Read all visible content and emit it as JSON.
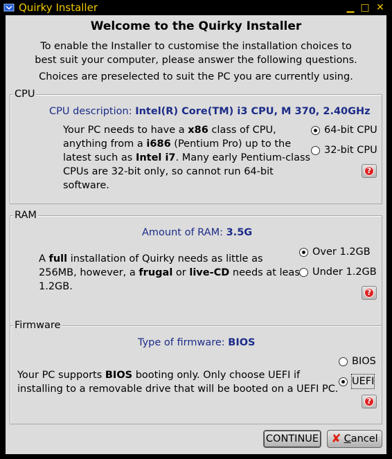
{
  "window": {
    "title": "Quirky Installer",
    "controls": {
      "minimize": "▁",
      "maximize": "□",
      "close": "✕"
    },
    "accent_color": "#f0c800"
  },
  "intro": {
    "heading": "Welcome to the Quirky Installer",
    "line1": "To enable the Installer to customise the installation choices to",
    "line2": "best suit your computer, please answer the following questions.",
    "line3": "Choices are preselected to suit the PC you are currently using."
  },
  "cpu": {
    "frame_label": "CPU",
    "desc_label": "CPU description:",
    "desc_value": "Intel(R) Core(TM) i3 CPU, M 370, 2.40GHz",
    "para": {
      "t1": "Your PC needs to have a ",
      "b1": "x86",
      "t2": " class of CPU,",
      "t3": "anything from a ",
      "b2": "i686",
      "t4": " (Pentium Pro) up to the",
      "t5": "latest such as ",
      "b3": "Intel i7",
      "t6": ". Many early Pentium-class",
      "t7": "CPUs are 32-bit only, so cannot run 64-bit",
      "t8": "software."
    },
    "options": [
      {
        "label": "64-bit CPU",
        "selected": true
      },
      {
        "label": "32-bit CPU",
        "selected": false
      }
    ]
  },
  "ram": {
    "frame_label": "RAM",
    "desc_label": "Amount of RAM:",
    "desc_value": "3.5G",
    "para": {
      "t1": "A ",
      "b1": "full",
      "t2": " installation of Quirky needs as little as",
      "t3": "256MB, however, a ",
      "b2": "frugal",
      "t4": " or ",
      "b3": "live-CD",
      "t5": " needs at least",
      "t6": "1.2GB."
    },
    "options": [
      {
        "label": "Over 1.2GB",
        "selected": true
      },
      {
        "label": "Under 1.2GB",
        "selected": false
      }
    ]
  },
  "firmware": {
    "frame_label": "Firmware",
    "desc_label": "Type of firmware:",
    "desc_value": "BIOS",
    "para": {
      "t1": "Your PC supports ",
      "b1": "BIOS",
      "t2": " booting only. Only choose UEFI if",
      "t3": "installing to a removable drive that will be booted on a UEFI PC."
    },
    "options": [
      {
        "label": "BIOS",
        "selected": false
      },
      {
        "label": "UEFI",
        "selected": true
      }
    ]
  },
  "help_glyph": "?",
  "buttons": {
    "continue": "CONTINUE",
    "cancel_icon": "✘",
    "cancel_mnemonic": "C",
    "cancel_rest": "ancel"
  }
}
